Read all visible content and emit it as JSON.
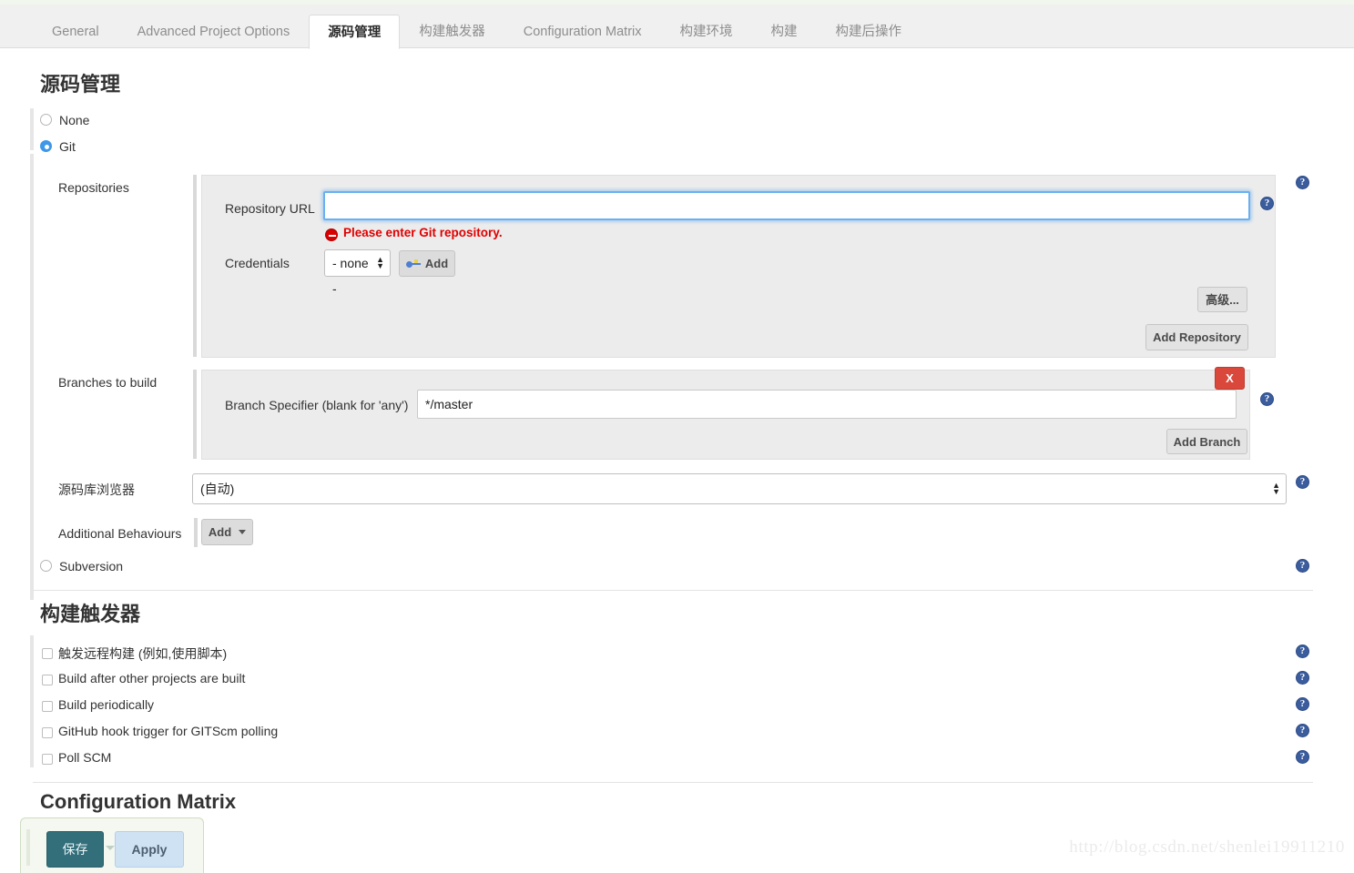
{
  "tabs": [
    {
      "label": "General",
      "active": false
    },
    {
      "label": "Advanced Project Options",
      "active": false
    },
    {
      "label": "源码管理",
      "active": true
    },
    {
      "label": "构建触发器",
      "active": false
    },
    {
      "label": "Configuration Matrix",
      "active": false
    },
    {
      "label": "构建环境",
      "active": false
    },
    {
      "label": "构建",
      "active": false
    },
    {
      "label": "构建后操作",
      "active": false
    }
  ],
  "scm": {
    "title": "源码管理",
    "options": [
      {
        "label": "None",
        "selected": false
      },
      {
        "label": "Git",
        "selected": true
      },
      {
        "label": "Subversion",
        "selected": false
      }
    ],
    "repositories": {
      "label": "Repositories",
      "repository_url": {
        "label": "Repository URL",
        "value": "",
        "error": "Please enter Git repository."
      },
      "credentials": {
        "label": "Credentials",
        "value": "- none -",
        "add_label": "Add"
      },
      "advanced_label": "高级...",
      "add_repository_label": "Add Repository"
    },
    "branches": {
      "label": "Branches to build",
      "specifier_label": "Branch Specifier (blank for 'any')",
      "specifier_value": "*/master",
      "delete_label": "X",
      "add_branch_label": "Add Branch"
    },
    "browser": {
      "label": "源码库浏览器",
      "value": "(自动)"
    },
    "additional_behaviours": {
      "label": "Additional Behaviours",
      "add_label": "Add"
    }
  },
  "triggers": {
    "title": "构建触发器",
    "items": [
      {
        "label": "触发远程构建 (例如,使用脚本)",
        "checked": false
      },
      {
        "label": "Build after other projects are built",
        "checked": false
      },
      {
        "label": "Build periodically",
        "checked": false
      },
      {
        "label": "GitHub hook trigger for GITScm polling",
        "checked": false
      },
      {
        "label": "Poll SCM",
        "checked": false
      }
    ]
  },
  "matrix": {
    "title": "Configuration Matrix"
  },
  "footer": {
    "save_label": "保存",
    "apply_label": "Apply"
  },
  "watermark": {
    "text": "http://blog.csdn.net/shenlei19911210"
  },
  "icons": {
    "help": "?"
  },
  "colors": {
    "accent_blue": "#3e97e8",
    "error_red": "#e00000",
    "delete_red": "#d9483b",
    "save_teal": "#336e7b",
    "apply_blue": "#cfe2f3",
    "help_blue": "#3b5d9e"
  }
}
